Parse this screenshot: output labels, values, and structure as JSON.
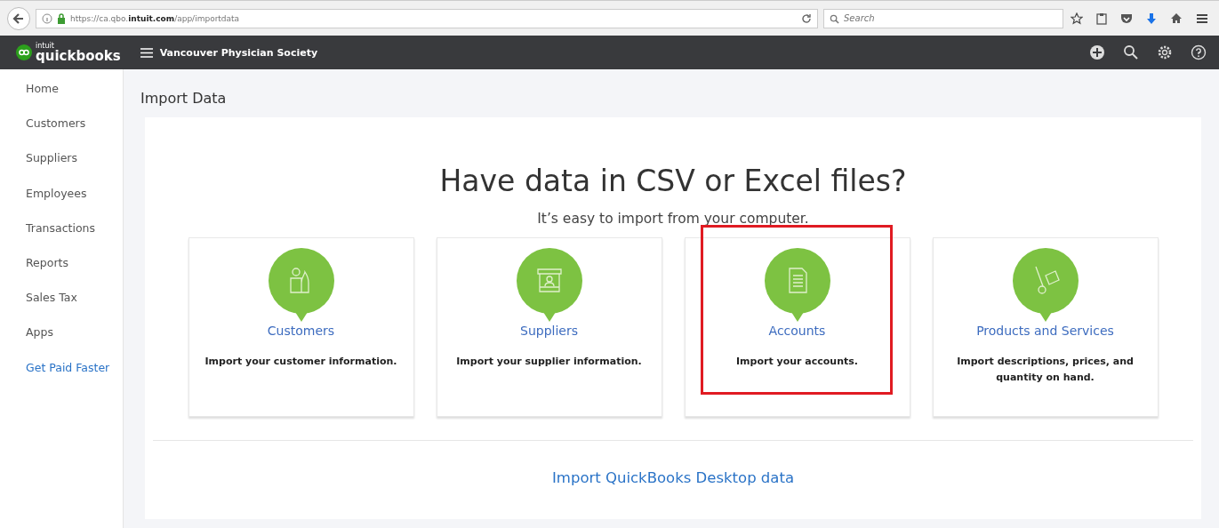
{
  "browser": {
    "url": "https://ca.qbo.**intuit.com**/app/importdata",
    "search": {
      "placeholder": "Search"
    }
  },
  "header": {
    "logo_small": "intuit",
    "logo": "quickbooks",
    "company": "Vancouver Physician Society"
  },
  "sidebar": {
    "items": [
      {
        "label": "Home",
        "kind": "nav"
      },
      {
        "label": "Customers",
        "kind": "nav"
      },
      {
        "label": "Suppliers",
        "kind": "nav"
      },
      {
        "label": "Employees",
        "kind": "nav"
      },
      {
        "label": "Transactions",
        "kind": "nav"
      },
      {
        "label": "Reports",
        "kind": "nav"
      },
      {
        "label": "Sales Tax",
        "kind": "nav"
      },
      {
        "label": "Apps",
        "kind": "nav"
      },
      {
        "label": "Get Paid Faster",
        "kind": "link"
      }
    ]
  },
  "page_title": "Import Data",
  "heading": "Have data in CSV or Excel files?",
  "subheading": "It’s easy to import from your computer.",
  "cards": [
    {
      "kind": "customers",
      "title": "Customers",
      "description": "Import your customer information.",
      "highlighted": false
    },
    {
      "kind": "suppliers",
      "title": "Suppliers",
      "description": "Import your supplier information.",
      "highlighted": false
    },
    {
      "kind": "accounts",
      "title": "Accounts",
      "description": "Import your accounts.",
      "highlighted": true
    },
    {
      "kind": "products",
      "title": "Products and Services",
      "description": "Import descriptions, prices, and quantity on hand.",
      "highlighted": false
    }
  ],
  "desktop_link": "Import QuickBooks Desktop data"
}
